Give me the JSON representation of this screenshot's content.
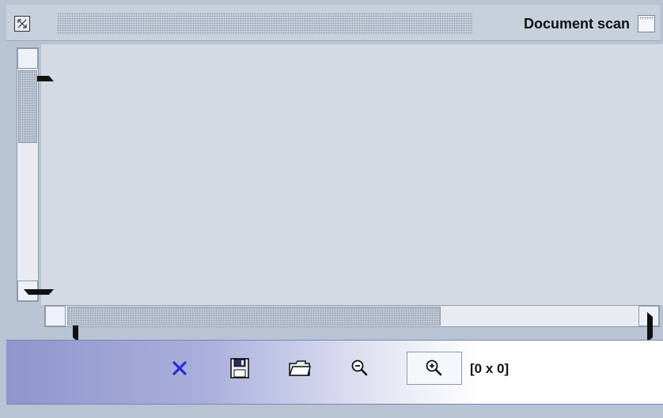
{
  "window": {
    "title": "Document scan"
  },
  "icons": {
    "system": "window-system-icon",
    "maximize": "maximize-icon",
    "close": "close-x-icon",
    "save": "floppy-disk-icon",
    "open": "folder-icon",
    "zoom_out": "zoom-out-icon",
    "zoom_in": "zoom-in-icon"
  },
  "toolbar": {
    "size_label": "[0 x 0]"
  },
  "colors": {
    "accent_x": "#2a2ad8",
    "toolbar_gradient_start": "#8f96cc"
  }
}
